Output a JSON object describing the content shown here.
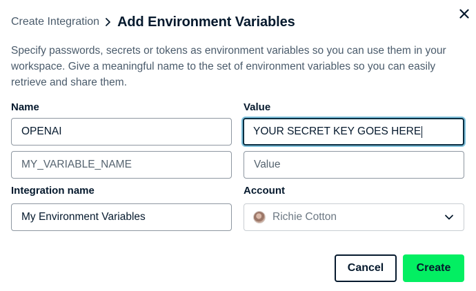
{
  "header": {
    "breadcrumb": "Create Integration",
    "title": "Add Environment Variables",
    "chevron_icon": "chevron-right-icon",
    "close_icon": "close-icon"
  },
  "description": "Specify passwords, secrets or tokens as environment variables so you can use them in your workspace. Give a meaningful name to the set of environment variables so you can easily retrieve and share them.",
  "variables": {
    "name_label": "Name",
    "value_label": "Value",
    "rows": [
      {
        "name": "OPENAI",
        "value": "YOUR SECRET KEY GOES HERE"
      },
      {
        "name_placeholder": "MY_VARIABLE_NAME",
        "value_placeholder": "Value"
      }
    ]
  },
  "integration": {
    "label": "Integration name",
    "value": "My Environment Variables"
  },
  "account": {
    "label": "Account",
    "selected": "Richie Cotton",
    "icon": "chevron-down-icon"
  },
  "actions": {
    "cancel": "Cancel",
    "create": "Create"
  },
  "colors": {
    "text": "#05192d",
    "muted": "#4a5b6b",
    "focus_ring": "#7fc1dc",
    "primary": "#03ef62"
  }
}
